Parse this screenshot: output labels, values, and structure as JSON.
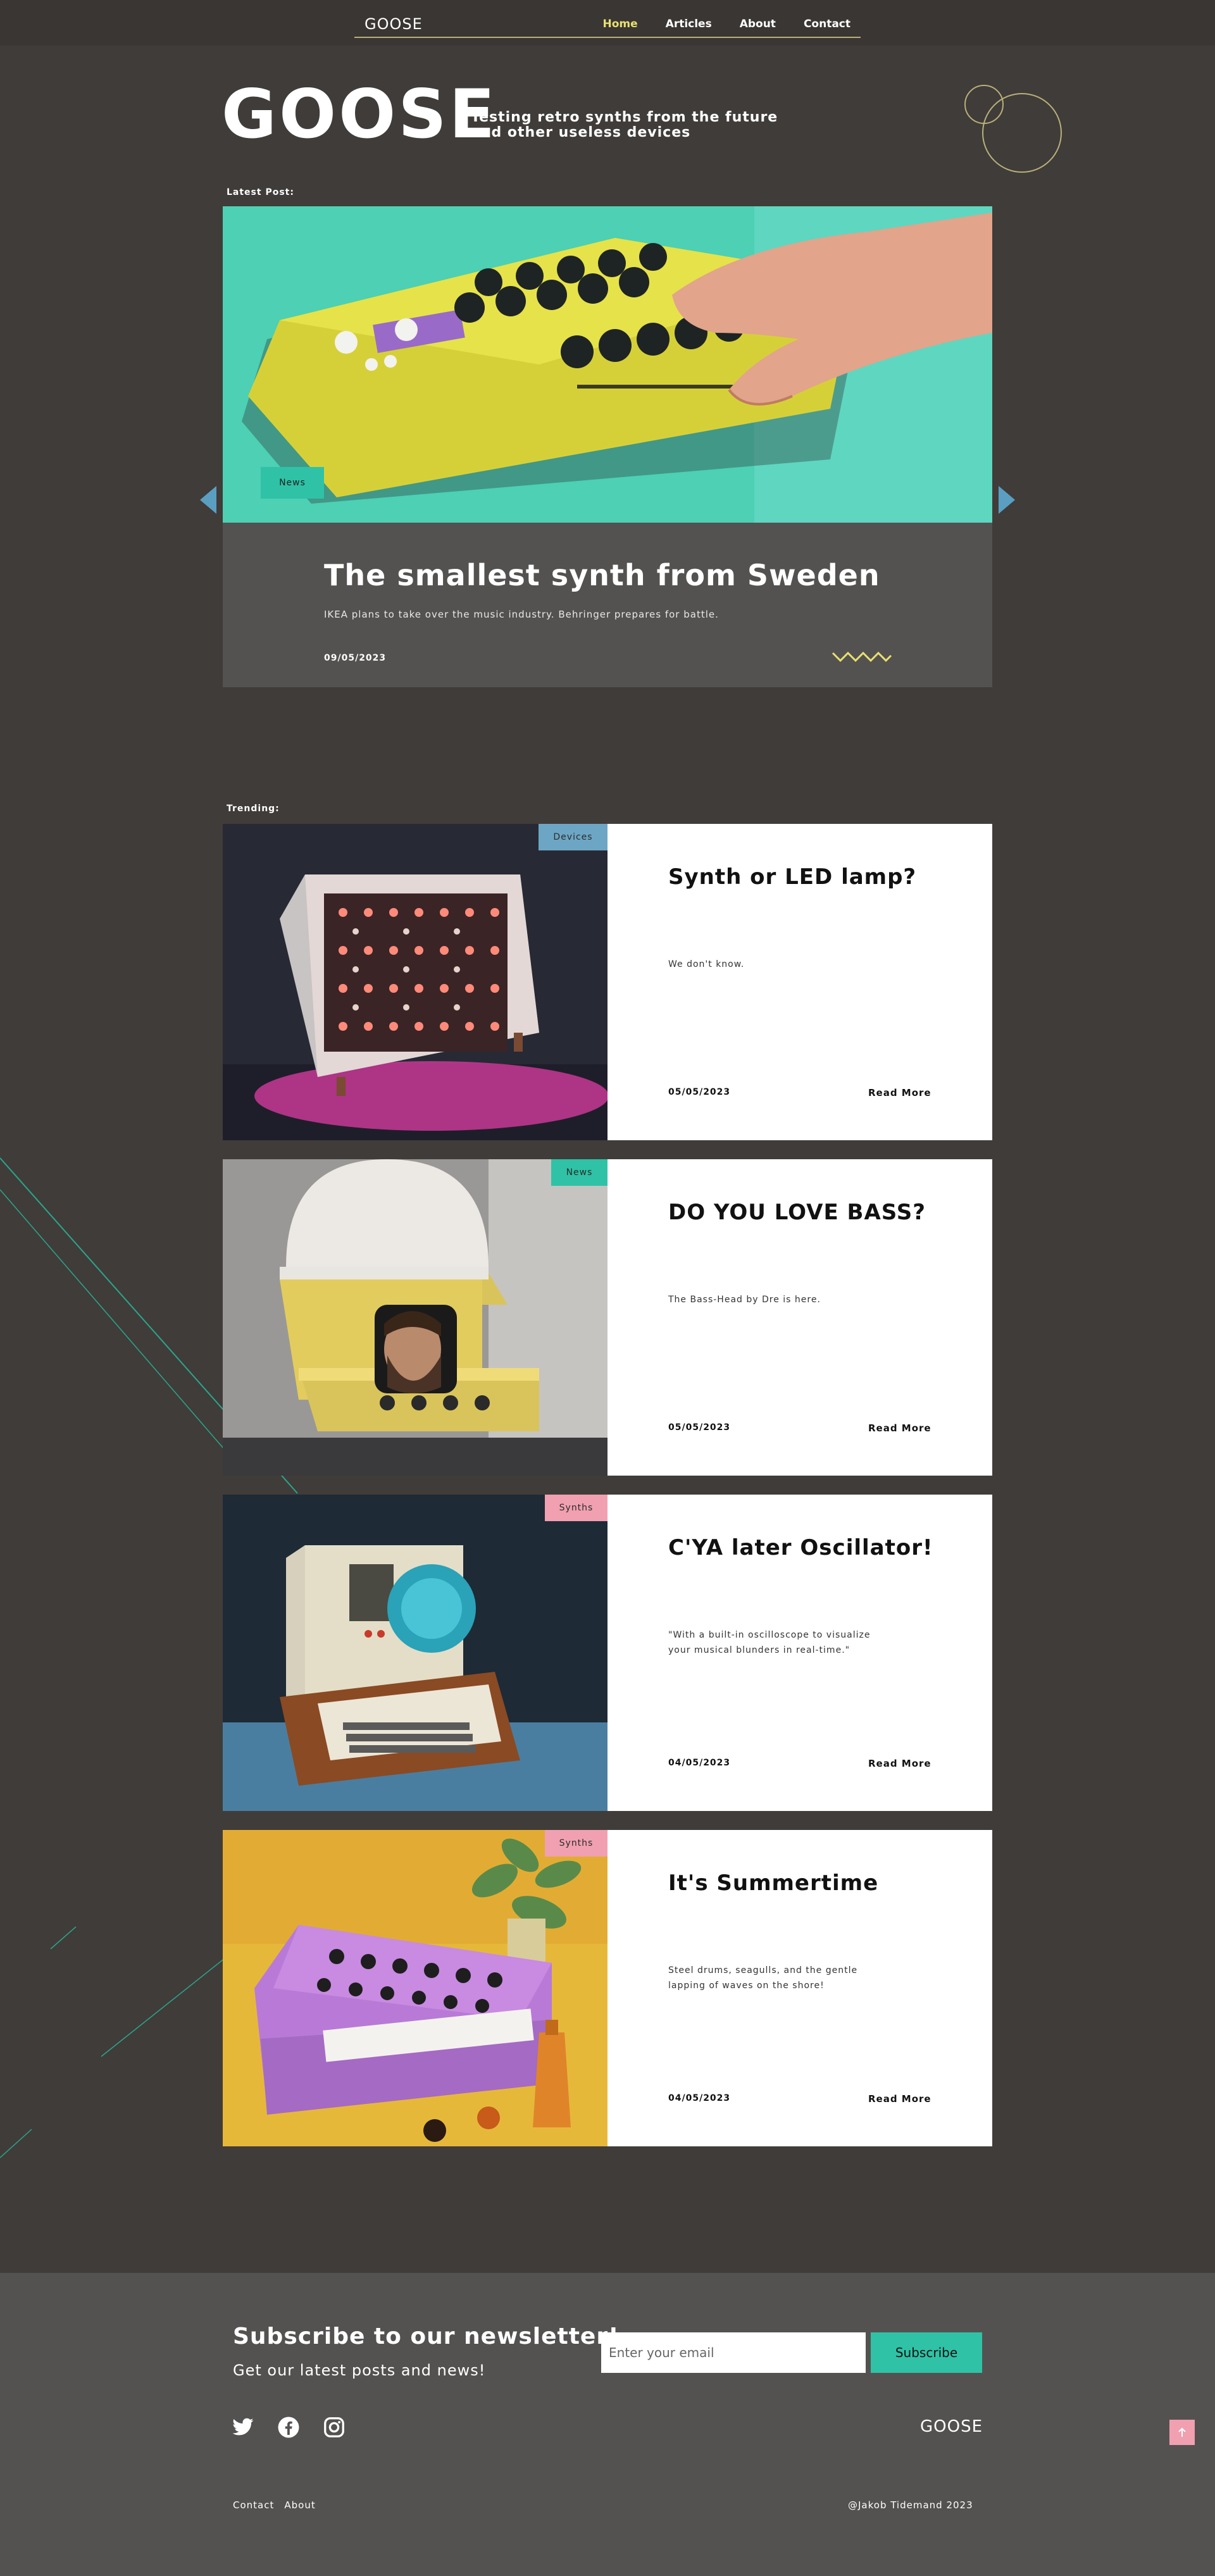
{
  "colors": {
    "background": "#403c39",
    "accent_yellow": "#e8e071",
    "accent_teal": "#2fc2a6",
    "accent_blue": "#6ca6c4",
    "accent_pink": "#f0a0b0"
  },
  "nav": {
    "logo": "GOOSE",
    "links": [
      "Home",
      "Articles",
      "About",
      "Contact"
    ],
    "active": "Home"
  },
  "hero": {
    "brand": "GOOSE",
    "tagline": "Testing retro synths from the future and other useless devices"
  },
  "latest": {
    "label": "Latest Post:",
    "badge": "News",
    "title": "The smallest synth from Sweden",
    "subtitle": "IKEA plans to take over the music industry. Behringer prepares for battle.",
    "date": "09/05/2023",
    "prev_icon": "arrow-left-icon",
    "next_icon": "arrow-right-icon"
  },
  "trending": {
    "label": "Trending:",
    "read_more": "Read More",
    "posts": [
      {
        "badge": "Devices",
        "badge_color": "#6ca6c4",
        "title": "Synth or LED lamp?",
        "text": "We don't know.",
        "date": "05/05/2023"
      },
      {
        "badge": "News",
        "badge_color": "#2fc2a6",
        "title": "DO YOU LOVE BASS?",
        "text": "The Bass-Head by Dre is here.",
        "date": "05/05/2023"
      },
      {
        "badge": "Synths",
        "badge_color": "#f0a0b0",
        "title": "C'YA later Oscillator!",
        "text": "\"With a built-in oscilloscope to visualize your musical blunders in real-time.\"",
        "date": "04/05/2023"
      },
      {
        "badge": "Synths",
        "badge_color": "#f0a0b0",
        "title": "It's Summertime",
        "text": "Steel drums, seagulls, and the gentle lapping of waves on the shore!",
        "date": "04/05/2023"
      }
    ]
  },
  "footer": {
    "newsletter_title": "Subscribe to our newsletter!",
    "newsletter_sub": "Get our latest posts and news!",
    "email_placeholder": "Enter your email",
    "subscribe": "Subscribe",
    "social_icons": [
      "twitter-icon",
      "facebook-icon",
      "instagram-icon"
    ],
    "logo": "GOOSE",
    "links": [
      "Contact",
      "About"
    ],
    "copyright": "@Jakob Tidemand 2023"
  }
}
